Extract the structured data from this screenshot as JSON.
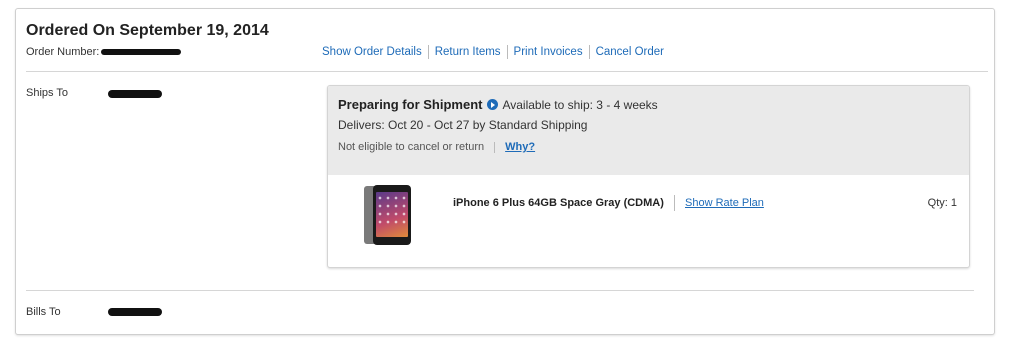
{
  "order": {
    "title": "Ordered On September 19, 2014",
    "number_label": "Order Number:",
    "actions": [
      "Show Order Details",
      "Return Items",
      "Print Invoices",
      "Cancel Order"
    ]
  },
  "ships_to": {
    "label": "Ships To"
  },
  "bills_to": {
    "label": "Bills To"
  },
  "shipment": {
    "status": "Preparing for Shipment",
    "availability": "Available to ship: 3 - 4 weeks",
    "delivers": "Delivers: Oct 20 - Oct 27 by Standard Shipping",
    "cancel_note": "Not eligible to cancel or return",
    "why_label": "Why?",
    "item": {
      "name": "iPhone 6 Plus 64GB Space Gray (CDMA)",
      "rate_plan_label": "Show Rate Plan",
      "qty": "Qty: 1",
      "image_icon": "iphone-product-image"
    }
  },
  "colors": {
    "link": "#1e6bb8",
    "header_bg": "#eaeaea"
  }
}
